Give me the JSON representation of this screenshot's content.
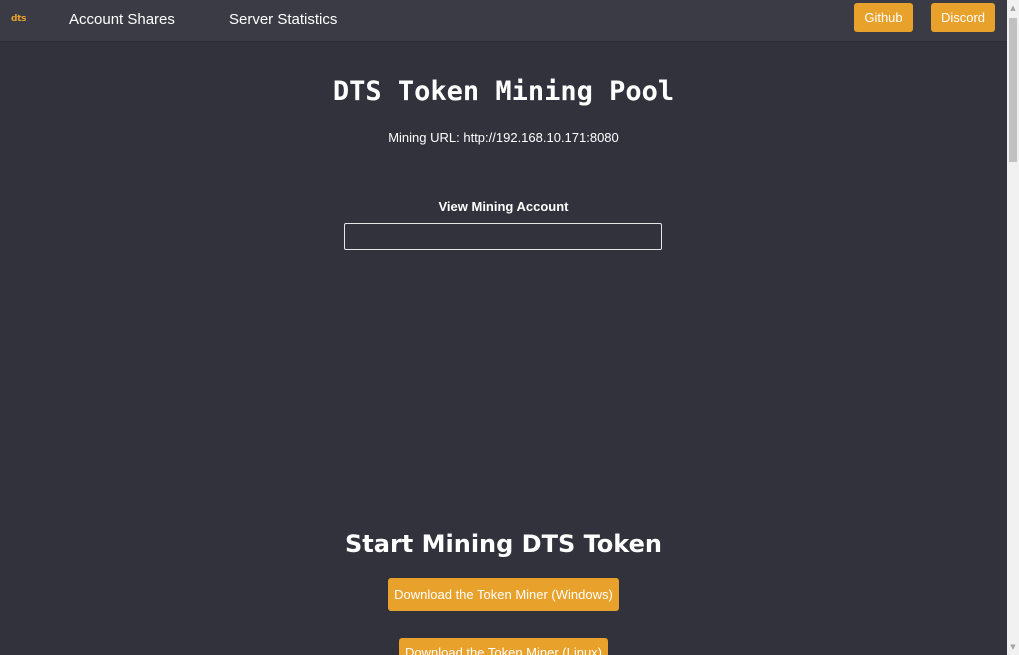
{
  "navbar": {
    "logo": "dts",
    "links": {
      "account_shares": "Account Shares",
      "server_statistics": "Server Statistics"
    },
    "buttons": {
      "github": "Github",
      "discord": "Discord"
    }
  },
  "main": {
    "title": "DTS Token Mining Pool",
    "mining_url": "Mining URL: http://192.168.10.171:8080",
    "account_label": "View Mining Account",
    "account_input_value": "",
    "start_heading": "Start Mining DTS Token",
    "download_windows": "Download the Token Miner (Windows)",
    "download_linux": "Download the Token Miner (Linux)"
  },
  "scrollbar": {
    "up_arrow_icon": "▲",
    "down_arrow_icon": "▼"
  },
  "colors": {
    "background": "#32323d",
    "navbar": "#3b3b45",
    "accent": "#e8a12b"
  }
}
